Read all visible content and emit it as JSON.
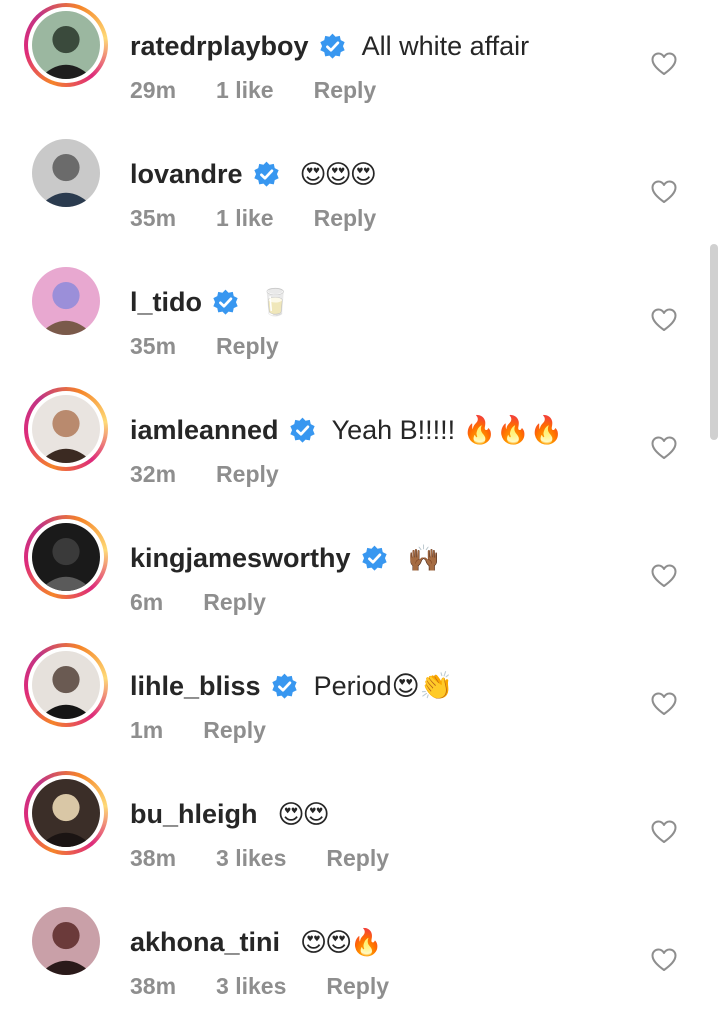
{
  "comments": [
    {
      "username": "ratedrplayboy",
      "verified": true,
      "text": "All white affair",
      "emoji": "",
      "time": "29m",
      "likes": "1 like",
      "reply": "Reply",
      "avatar_ring": true,
      "avatar_colors": [
        "#9bb7a0",
        "#3a4a3c",
        "#1e1e1e"
      ]
    },
    {
      "username": "lovandre",
      "verified": true,
      "text": "",
      "emoji": "😍😍😍",
      "time": "35m",
      "likes": "1 like",
      "reply": "Reply",
      "avatar_ring": false,
      "avatar_colors": [
        "#c9c9c9",
        "#6b6b6b",
        "#2b3b4f"
      ]
    },
    {
      "username": "l_tido",
      "verified": true,
      "text": "",
      "emoji": "🥛",
      "time": "35m",
      "likes": "",
      "reply": "Reply",
      "avatar_ring": false,
      "avatar_colors": [
        "#e8a8d0",
        "#9b8fd9",
        "#7a5a4a"
      ]
    },
    {
      "username": "iamleanned",
      "verified": true,
      "text": "Yeah B!!!!! 🔥🔥🔥",
      "emoji": "",
      "time": "32m",
      "likes": "",
      "reply": "Reply",
      "avatar_ring": true,
      "avatar_colors": [
        "#e9e4e0",
        "#b98a6e",
        "#3b2a22"
      ]
    },
    {
      "username": "kingjamesworthy",
      "verified": true,
      "text": "",
      "emoji": "🙌🏾",
      "time": "6m",
      "likes": "",
      "reply": "Reply",
      "avatar_ring": true,
      "avatar_colors": [
        "#1a1a1a",
        "#3a3a3a",
        "#5a5a5a"
      ]
    },
    {
      "username": "lihle_bliss",
      "verified": true,
      "text": "Period😍👏",
      "emoji": "",
      "time": "1m",
      "likes": "",
      "reply": "Reply",
      "avatar_ring": true,
      "avatar_colors": [
        "#e6e1dc",
        "#6a5a52",
        "#151515"
      ]
    },
    {
      "username": "bu_hleigh",
      "verified": false,
      "text": "",
      "emoji": "😍😍",
      "time": "38m",
      "likes": "3 likes",
      "reply": "Reply",
      "avatar_ring": true,
      "avatar_colors": [
        "#3b2e28",
        "#d9c7a6",
        "#1b1413"
      ]
    },
    {
      "username": "akhona_tini",
      "verified": false,
      "text": "",
      "emoji": "😍😍🔥",
      "time": "38m",
      "likes": "3 likes",
      "reply": "Reply",
      "avatar_ring": false,
      "avatar_colors": [
        "#c9a0a8",
        "#6b3a3a",
        "#2a1a1a"
      ]
    }
  ],
  "colors": {
    "verified": "#3897f0",
    "username": "#262626",
    "meta": "#8e8e8e",
    "heart": "#8e8e8e"
  },
  "icons": {
    "verified": "verified-badge-icon",
    "like": "heart-outline-icon"
  }
}
